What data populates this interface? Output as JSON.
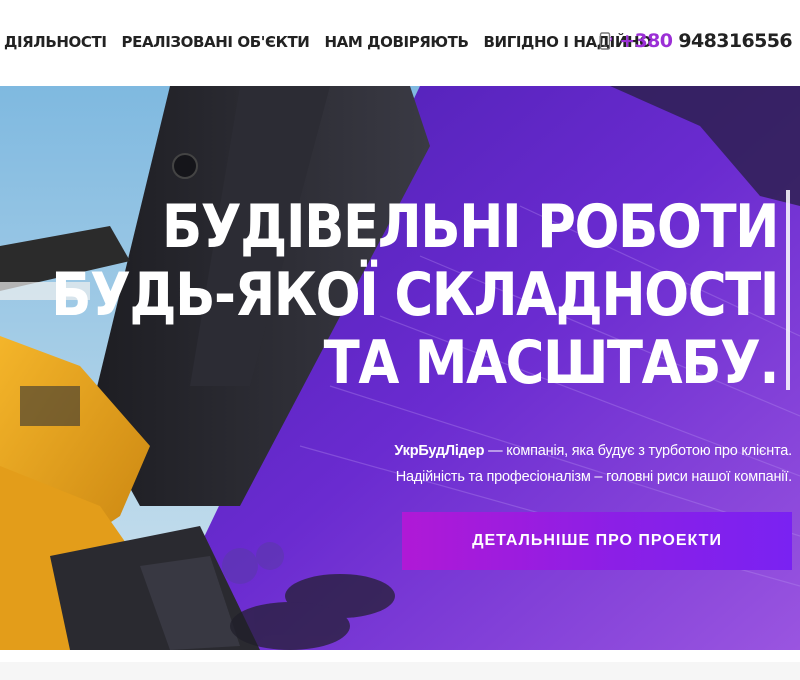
{
  "nav": {
    "items": [
      {
        "label": "ДІЯЛЬНОСТІ"
      },
      {
        "label": "РЕАЛІЗОВАНІ ОБ'ЄКТИ"
      },
      {
        "label": "НАМ ДОВІРЯЮТЬ"
      },
      {
        "label": "ВИГІДНО І НАДІЙНО"
      }
    ]
  },
  "phone": {
    "icon": "phone-icon",
    "prefix": "+380",
    "number": "948316556"
  },
  "hero": {
    "headline": [
      "БУДІВЕЛЬНІ РОБОТИ",
      "БУДЬ-ЯКОЇ СКЛАДНОСТІ",
      "ТА МАСШТАБУ."
    ],
    "brand": "УкрБудЛідер",
    "tagline_rest": " — компанія, яка будує з турботою про клієнта.",
    "tagline_line2": "Надійність та професіоналізм – головні риси нашої компанії.",
    "cta_label": "ДЕТАЛЬНІШЕ ПРО ПРОЕКТИ"
  },
  "colors": {
    "accent": "#9b2fd6",
    "overlay": "#6a24c9",
    "cta_start": "#b019d6",
    "cta_end": "#7a22f2",
    "machine": "#e8a21c"
  }
}
